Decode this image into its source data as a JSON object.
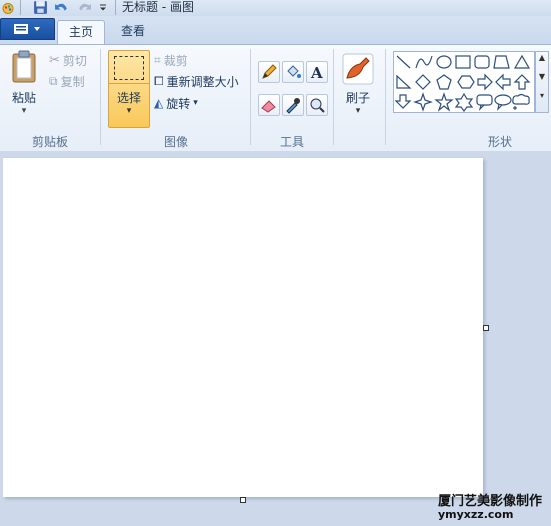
{
  "window": {
    "title": "无标题 - 画图"
  },
  "tabs": [
    {
      "label": "主页",
      "active": true
    },
    {
      "label": "查看",
      "active": false
    }
  ],
  "clipboard": {
    "paste_label": "粘贴",
    "cut_label": "剪切",
    "copy_label": "复制",
    "group_label": "剪贴板"
  },
  "image": {
    "select_label": "选择",
    "crop_label": "裁剪",
    "resize_label": "重新调整大小",
    "rotate_label": "旋转",
    "group_label": "图像"
  },
  "tools": {
    "items": [
      "pencil-icon",
      "fill-icon",
      "text-icon",
      "eraser-icon",
      "color-picker-icon",
      "magnifier-icon"
    ],
    "group_label": "工具"
  },
  "brushes": {
    "label": "刷子"
  },
  "shapes": {
    "group_label": "形状",
    "items": [
      "line",
      "curve",
      "oval",
      "rectangle",
      "rounded-rectangle",
      "polygon",
      "triangle",
      "right-triangle",
      "diamond",
      "pentagon",
      "hexagon",
      "right-arrow",
      "left-arrow",
      "up-arrow",
      "down-arrow",
      "four-point-star",
      "five-point-star",
      "six-point-star",
      "rounded-callout",
      "oval-callout",
      "cloud-callout"
    ]
  },
  "watermark": {
    "line1": "厦门艺美影像制作",
    "line2": "ymyxzz.com"
  },
  "colors": {
    "accent": "#1a4fa0",
    "selected_button": "#fdd37a"
  }
}
